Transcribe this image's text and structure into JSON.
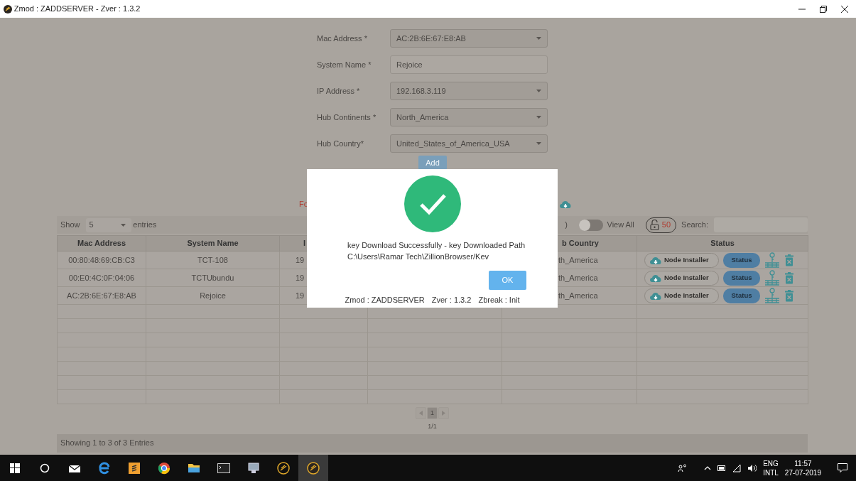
{
  "window": {
    "title": "Zmod : ZADDSERVER - Zver : 1.3.2"
  },
  "form": {
    "fields": [
      {
        "label": "Mac Address *",
        "value": "AC:2B:6E:67:E8:AB",
        "kind": "select"
      },
      {
        "label": "System Name *",
        "value": "Rejoice",
        "kind": "text"
      },
      {
        "label": "IP Address *",
        "value": "192.168.3.119",
        "kind": "select"
      },
      {
        "label": "Hub Continents *",
        "value": "North_America",
        "kind": "select"
      },
      {
        "label": "Hub Country*",
        "value": "United_States_of_America_USA",
        "kind": "select"
      }
    ],
    "add_button": "Add"
  },
  "notice": {
    "text": "Fo"
  },
  "table_toolbar": {
    "show_label": "Show",
    "page_size": "5",
    "entries_label": "entries",
    "cut_text": ")",
    "view_all": {
      "label": "View All",
      "on": false
    },
    "lock_count": "50",
    "search_label": "Search:"
  },
  "table": {
    "columns": [
      "Mac Address",
      "System Name",
      "I",
      "b Country",
      "Status"
    ],
    "rows": [
      {
        "mac_address": "00:80:48:69:CB:C3",
        "system_name": "TCT-108",
        "column_3": "19",
        "column_5": "th_America",
        "install_button": "Node Installer",
        "status_button": "Status"
      },
      {
        "mac_address": "00:E0:4C:0F:04:06",
        "system_name": "TCTUbundu",
        "column_3": "19",
        "column_5": "th_America",
        "install_button": "Node Installer",
        "status_button": "Status"
      },
      {
        "mac_address": "AC:2B:6E:67:E8:AB",
        "system_name": "Rejoice",
        "column_3": "19",
        "column_5": "th_America",
        "install_button": "Node Installer",
        "status_button": "Status"
      }
    ]
  },
  "pagination": {
    "pages": [
      {
        "label": "1",
        "selected": true
      }
    ],
    "page_info": "1/1"
  },
  "footer": "Showing 1 to 3 of 3 Entries",
  "dialog": {
    "message_lines": [
      "key Download Successfully - key Downloaded Path",
      "C:\\Users\\Ramar Tech\\ZillionBrowser/Kev"
    ],
    "ok_button": "OK",
    "info": [
      "Zmod : ZADDSERVER",
      "Zver : 1.3.2",
      "Zbreak : Init"
    ]
  },
  "taskbar": {
    "language": "ENG",
    "layout": "INTL",
    "time": "11:57",
    "date": "27-07-2019"
  }
}
